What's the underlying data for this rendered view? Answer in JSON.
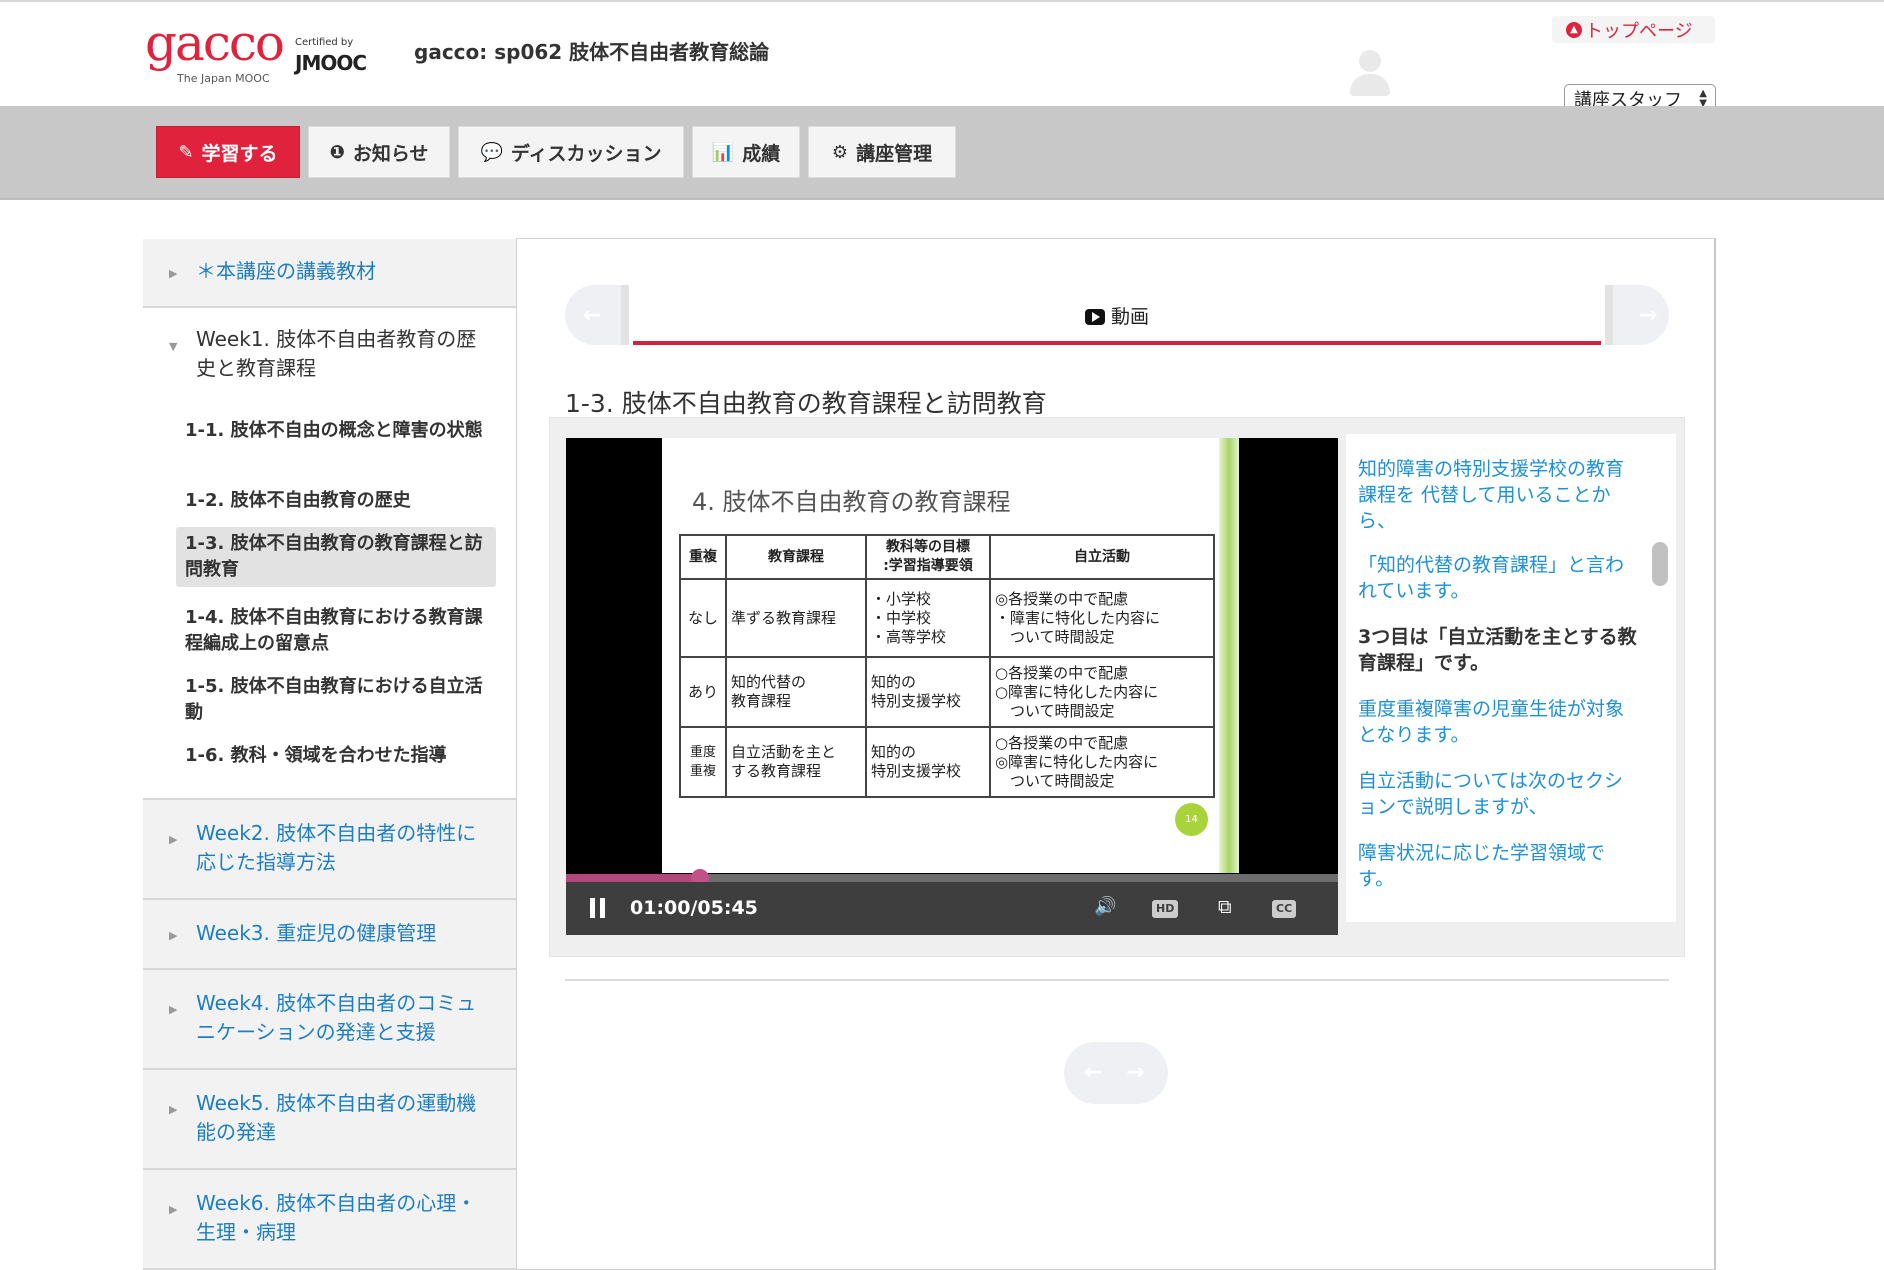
{
  "header": {
    "logo_text": "gacco",
    "logo_sub": "The Japan MOOC",
    "certified_by": "Certified by",
    "jmooc": "JMOOC",
    "course_title": "gacco: sp062 肢体不自由者教育総論",
    "top_page_label": "トップページ",
    "role_selected": "講座スタッフ"
  },
  "nav": {
    "items": [
      {
        "label": "学習する",
        "icon": "pencil-square-icon",
        "glyph": "✎"
      },
      {
        "label": "お知らせ",
        "icon": "info-circle-icon",
        "glyph": "❶"
      },
      {
        "label": "ディスカッション",
        "icon": "comments-icon",
        "glyph": "💬"
      },
      {
        "label": "成績",
        "icon": "bar-chart-icon",
        "glyph": "📊"
      },
      {
        "label": "講座管理",
        "icon": "cogs-icon",
        "glyph": "⚙"
      }
    ]
  },
  "sidebar": {
    "sections": [
      {
        "title": "＊本講座の講義教材"
      },
      {
        "title": "Week1. 肢体不自由者教育の歴史と教育課程"
      },
      {
        "title": "Week2. 肢体不自由者の特性に応じた指導方法"
      },
      {
        "title": "Week3. 重症児の健康管理"
      },
      {
        "title": "Week4. 肢体不自由者のコミュニケーションの発達と支援"
      },
      {
        "title": "Week5. 肢体不自由者の運動機能の発達"
      },
      {
        "title": "Week6. 肢体不自由者の心理・生理・病理"
      }
    ],
    "week1_items": [
      {
        "label": "1-1. 肢体不自由の概念と障害の状態"
      },
      {
        "label": "1-2. 肢体不自由教育の歴史"
      },
      {
        "label": "1-3. 肢体不自由教育の教育課程と訪問教育"
      },
      {
        "label": "1-4. 肢体不自由教育における教育課程編成上の留意点"
      },
      {
        "label": "1-5. 肢体不自由教育における自立活動"
      },
      {
        "label": "1-6. 教科・領域を合わせた指導"
      }
    ]
  },
  "main": {
    "tab_label": "動画",
    "unit_title": "1-3. 肢体不自由教育の教育課程と訪問教育",
    "slide": {
      "heading": "4. 肢体不自由教育の教育課程",
      "headers": [
        "重複",
        "教育課程",
        "教科等の目標\n:学習指導要領",
        "自立活動"
      ],
      "rows": [
        [
          "なし",
          "準ずる教育課程",
          "・小学校\n・中学校\n・高等学校",
          "◎各授業の中で配慮\n・障害に特化した内容に\n　ついて時間設定"
        ],
        [
          "あり",
          "知的代替の\n教育課程",
          "知的の\n特別支援学校",
          "○各授業の中で配慮\n○障害に特化した内容に\n　ついて時間設定"
        ],
        [
          "重度\n重複",
          "自立活動を主と\nする教育課程",
          "知的の\n特別支援学校",
          "○各授業の中で配慮\n◎障害に特化した内容に\n　ついて時間設定"
        ]
      ],
      "page_number": "14"
    },
    "video": {
      "time": "01:00/05:45",
      "progress": 0.174,
      "hd_label": "HD",
      "cc_label": "CC"
    },
    "transcript": [
      {
        "text": "知的障害の特別支援学校の教育課程を 代替して用いることから、",
        "active": false
      },
      {
        "text": "「知的代替の教育課程」と言われています。",
        "active": false
      },
      {
        "text": "3つ目は「自立活動を主とする教育課程」です。",
        "active": true
      },
      {
        "text": "重度重複障害の児童生徒が対象となります。",
        "active": false
      },
      {
        "text": "自立活動については次のセクションで説明しますが、",
        "active": false
      },
      {
        "text": "障害状況に応じた学習領域です。",
        "active": false
      }
    ]
  }
}
